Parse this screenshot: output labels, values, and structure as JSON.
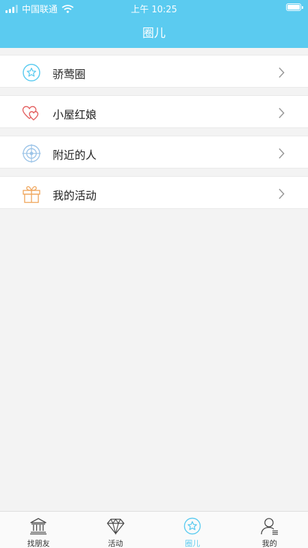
{
  "status_bar": {
    "carrier": "中国联通",
    "time": "上午 10:25"
  },
  "nav": {
    "title": "圈儿"
  },
  "colors": {
    "accent": "#5bcbf0",
    "heart": "#e35d5d",
    "radar": "#9cc4e8",
    "gift": "#f0a860"
  },
  "menu": [
    {
      "label": "骄莺圈",
      "icon": "star-circle-icon"
    },
    {
      "label": "小屋红娘",
      "icon": "hearts-icon"
    },
    {
      "label": "附近的人",
      "icon": "radar-icon"
    },
    {
      "label": "我的活动",
      "icon": "gift-icon"
    }
  ],
  "tabs": [
    {
      "label": "找朋友",
      "icon": "bank-icon",
      "active": false
    },
    {
      "label": "活动",
      "icon": "diamond-icon",
      "active": false
    },
    {
      "label": "圈儿",
      "icon": "star-circle-icon",
      "active": true
    },
    {
      "label": "我的",
      "icon": "user-icon",
      "active": false
    }
  ]
}
